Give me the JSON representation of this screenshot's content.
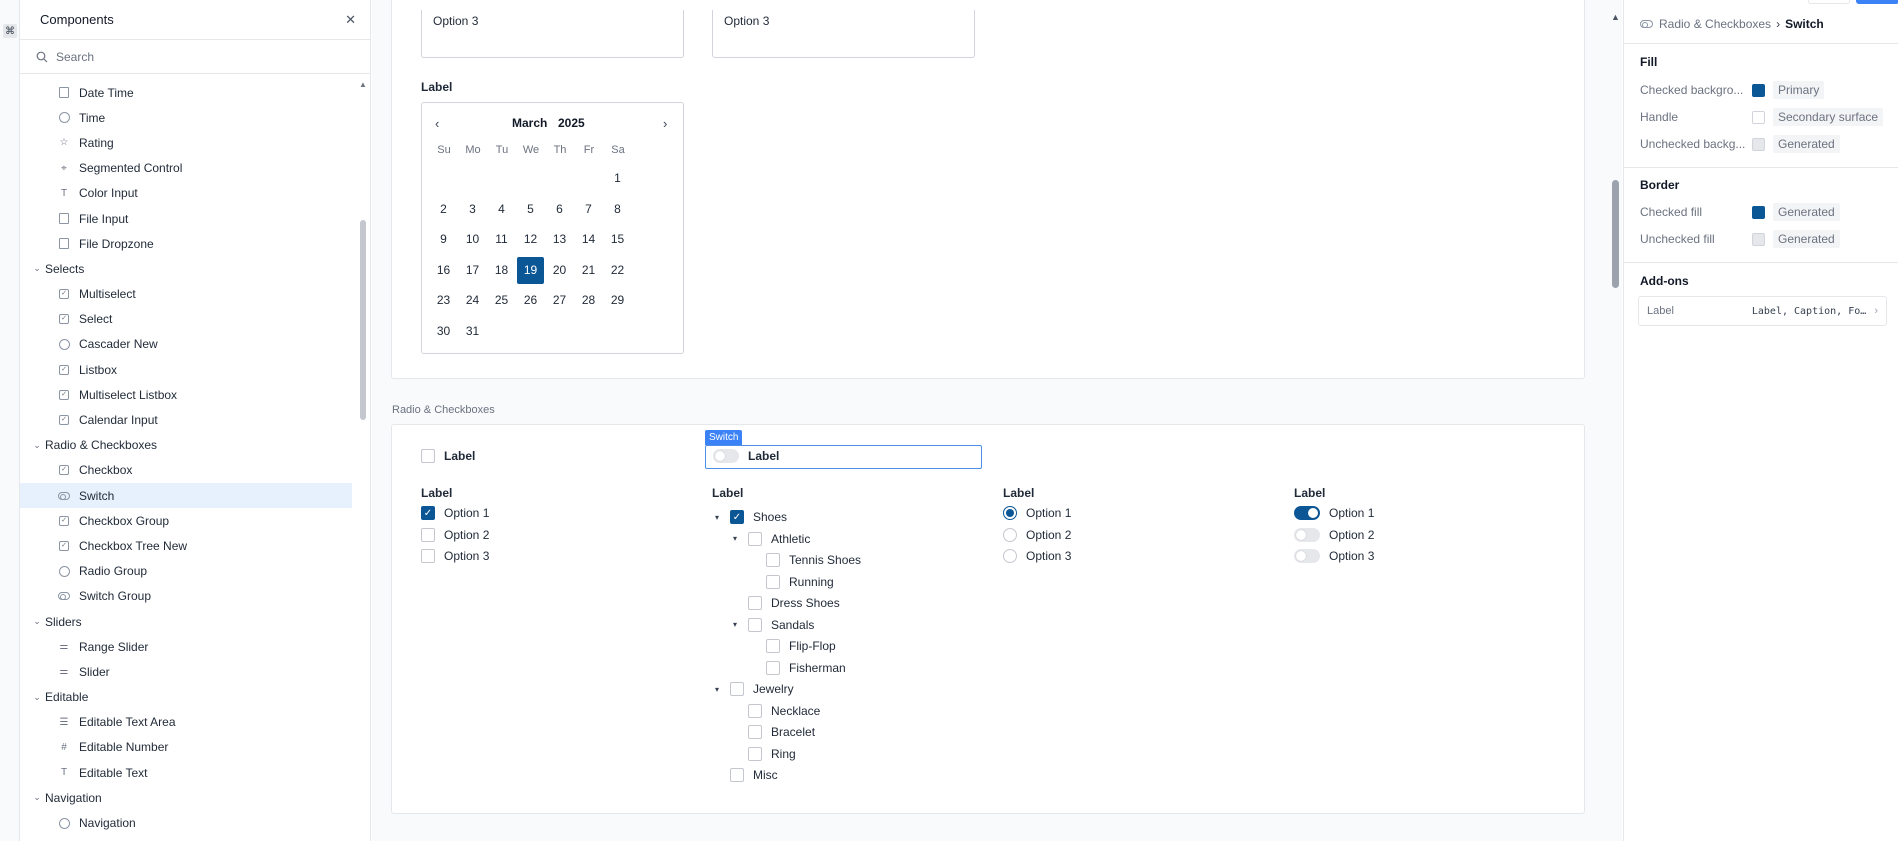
{
  "colors": {
    "primary": "#0b5796",
    "selection": "#e6f1fd",
    "accent_blue": "#3b82f6"
  },
  "left_panel": {
    "title": "Components",
    "search_placeholder": "Search",
    "tree": [
      {
        "type": "item",
        "label": "Date Time",
        "icon": "calendar-icon"
      },
      {
        "type": "item",
        "label": "Time",
        "icon": "clock-icon"
      },
      {
        "type": "item",
        "label": "Rating",
        "icon": "star-icon"
      },
      {
        "type": "item",
        "label": "Segmented Control",
        "icon": "segmented-icon"
      },
      {
        "type": "item",
        "label": "Color Input",
        "icon": "text-t-icon"
      },
      {
        "type": "item",
        "label": "File Input",
        "icon": "file-icon"
      },
      {
        "type": "item",
        "label": "File Dropzone",
        "icon": "file-icon"
      },
      {
        "type": "group",
        "label": "Selects"
      },
      {
        "type": "item",
        "label": "Multiselect",
        "icon": "checkbox-icon"
      },
      {
        "type": "item",
        "label": "Select",
        "icon": "checkbox-icon"
      },
      {
        "type": "item",
        "label": "Cascader New",
        "icon": "circle-check-icon"
      },
      {
        "type": "item",
        "label": "Listbox",
        "icon": "checkbox-icon"
      },
      {
        "type": "item",
        "label": "Multiselect Listbox",
        "icon": "checkbox-icon"
      },
      {
        "type": "item",
        "label": "Calendar Input",
        "icon": "checkbox-icon"
      },
      {
        "type": "group",
        "label": "Radio & Checkboxes"
      },
      {
        "type": "item",
        "label": "Checkbox",
        "icon": "checkbox-icon"
      },
      {
        "type": "item",
        "label": "Switch",
        "icon": "toggle-icon",
        "selected": true
      },
      {
        "type": "item",
        "label": "Checkbox Group",
        "icon": "checkbox-icon"
      },
      {
        "type": "item",
        "label": "Checkbox Tree New",
        "icon": "checkbox-icon"
      },
      {
        "type": "item",
        "label": "Radio Group",
        "icon": "radio-icon"
      },
      {
        "type": "item",
        "label": "Switch Group",
        "icon": "toggle-icon"
      },
      {
        "type": "group",
        "label": "Sliders"
      },
      {
        "type": "item",
        "label": "Range Slider",
        "icon": "slider-icon"
      },
      {
        "type": "item",
        "label": "Slider",
        "icon": "slider-icon"
      },
      {
        "type": "group",
        "label": "Editable"
      },
      {
        "type": "item",
        "label": "Editable Text Area",
        "icon": "text-area-icon"
      },
      {
        "type": "item",
        "label": "Editable Number",
        "icon": "hash-icon"
      },
      {
        "type": "item",
        "label": "Editable Text",
        "icon": "text-t-icon"
      },
      {
        "type": "group",
        "label": "Navigation"
      },
      {
        "type": "item",
        "label": "Navigation",
        "icon": "compass-icon"
      }
    ]
  },
  "canvas": {
    "top_options": [
      "Option 3",
      "Option 3"
    ],
    "calendar": {
      "label": "Label",
      "month": "March",
      "year": "2025",
      "prev": "‹",
      "next": "›",
      "weekdays": [
        "Su",
        "Mo",
        "Tu",
        "We",
        "Th",
        "Fr",
        "Sa"
      ],
      "first_weekday_index": 6,
      "days": [
        "1",
        "2",
        "3",
        "4",
        "5",
        "6",
        "7",
        "8",
        "9",
        "10",
        "11",
        "12",
        "13",
        "14",
        "15",
        "16",
        "17",
        "18",
        "19",
        "20",
        "21",
        "22",
        "23",
        "24",
        "25",
        "26",
        "27",
        "28",
        "29",
        "30",
        "31"
      ],
      "selected_day": "19"
    },
    "radio_section": {
      "title": "Radio & Checkboxes",
      "single_checkbox_label": "Label",
      "single_switch_label": "Label",
      "selection_tag": "Switch",
      "checkbox_group": {
        "label": "Label",
        "options": [
          {
            "label": "Option 1",
            "checked": true
          },
          {
            "label": "Option 2",
            "checked": false
          },
          {
            "label": "Option 3",
            "checked": false
          }
        ]
      },
      "checkbox_tree": {
        "label": "Label",
        "nodes": [
          {
            "label": "Shoes",
            "depth": 0,
            "expandable": true,
            "checked": true
          },
          {
            "label": "Athletic",
            "depth": 1,
            "expandable": true,
            "checked": false
          },
          {
            "label": "Tennis Shoes",
            "depth": 2,
            "expandable": false,
            "checked": false
          },
          {
            "label": "Running",
            "depth": 2,
            "expandable": false,
            "checked": false
          },
          {
            "label": "Dress Shoes",
            "depth": 1,
            "expandable": false,
            "checked": false
          },
          {
            "label": "Sandals",
            "depth": 1,
            "expandable": true,
            "checked": false
          },
          {
            "label": "Flip-Flop",
            "depth": 2,
            "expandable": false,
            "checked": false
          },
          {
            "label": "Fisherman",
            "depth": 2,
            "expandable": false,
            "checked": false
          },
          {
            "label": "Jewelry",
            "depth": 0,
            "expandable": true,
            "checked": false
          },
          {
            "label": "Necklace",
            "depth": 1,
            "expandable": false,
            "checked": false
          },
          {
            "label": "Bracelet",
            "depth": 1,
            "expandable": false,
            "checked": false
          },
          {
            "label": "Ring",
            "depth": 1,
            "expandable": false,
            "checked": false
          },
          {
            "label": "Misc",
            "depth": 0,
            "expandable": false,
            "checked": false
          }
        ]
      },
      "radio_group": {
        "label": "Label",
        "options": [
          {
            "label": "Option 1",
            "selected": true
          },
          {
            "label": "Option 2",
            "selected": false
          },
          {
            "label": "Option 3",
            "selected": false
          }
        ]
      },
      "switch_group": {
        "label": "Label",
        "options": [
          {
            "label": "Option 1",
            "on": true
          },
          {
            "label": "Option 2",
            "on": false
          },
          {
            "label": "Option 3",
            "on": false
          }
        ]
      }
    }
  },
  "right_panel": {
    "breadcrumb": {
      "parent": "Radio & Checkboxes",
      "separator": "›",
      "current": "Switch"
    },
    "fill": {
      "title": "Fill",
      "rows": [
        {
          "key": "Checked backgro...",
          "value": "Primary",
          "swatch": "#0b5796"
        },
        {
          "key": "Handle",
          "value": "Secondary surface",
          "swatch": "#ffffff"
        },
        {
          "key": "Unchecked backg...",
          "value": "Generated",
          "swatch": "#e5e7eb"
        }
      ]
    },
    "border": {
      "title": "Border",
      "rows": [
        {
          "key": "Checked fill",
          "value": "Generated",
          "swatch": "#0b5796"
        },
        {
          "key": "Unchecked fill",
          "value": "Generated",
          "swatch": "#e5e7eb"
        }
      ]
    },
    "addons": {
      "title": "Add-ons",
      "label_key": "Label",
      "label_value": "Label, Caption, Fon...",
      "chevron": "›"
    }
  }
}
